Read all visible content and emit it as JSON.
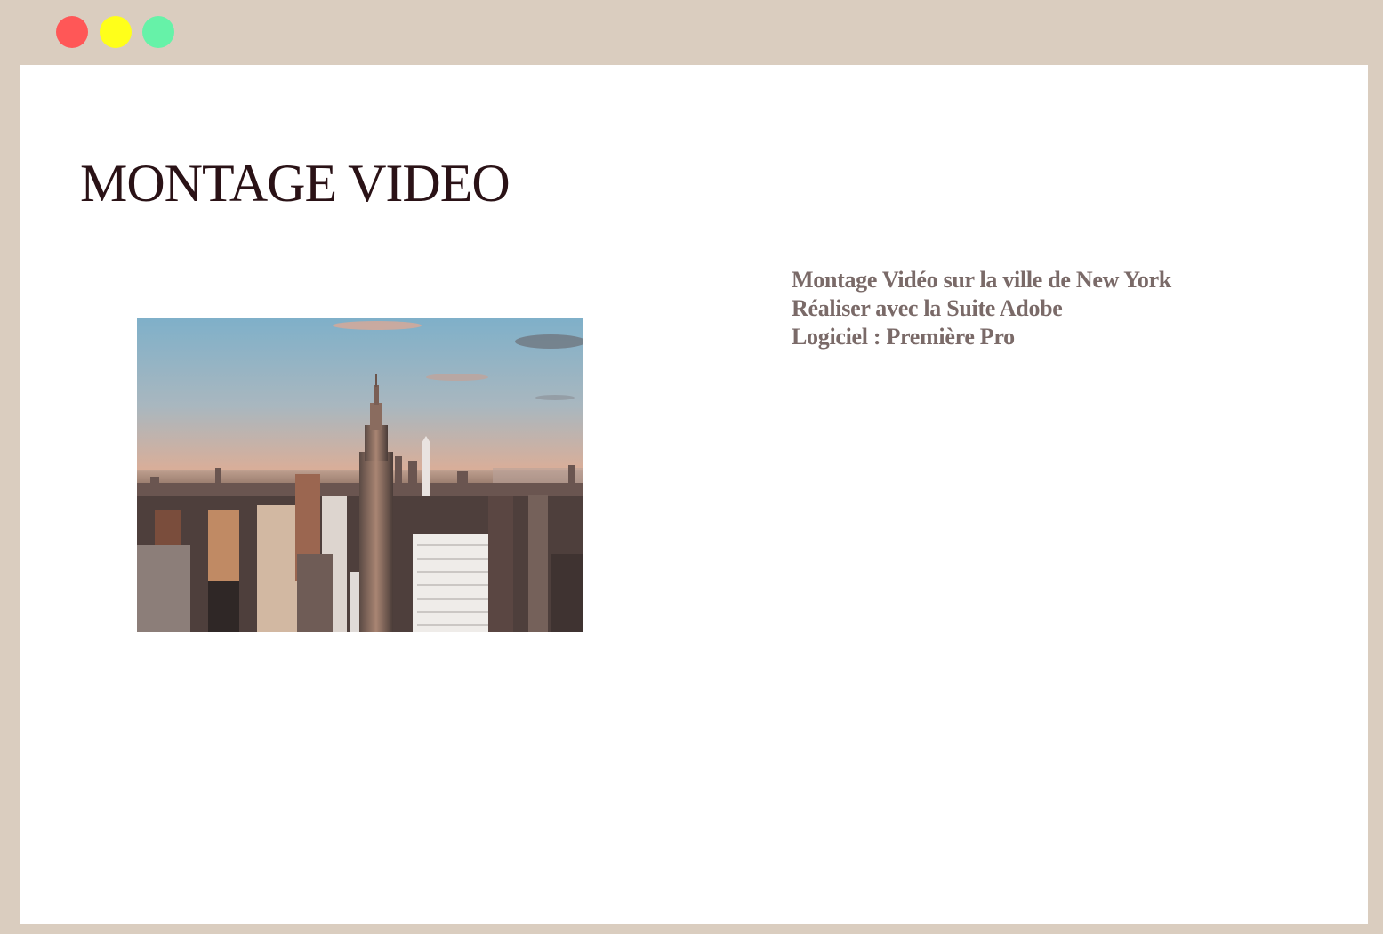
{
  "window": {
    "controls": {
      "close_color": "#ff5757",
      "minimize_color": "#ffff1a",
      "maximize_color": "#66f2a8"
    },
    "frame_color": "#dacdbf"
  },
  "page": {
    "title": "MONTAGE VIDEO",
    "description": [
      "Montage Vidéo sur la ville de New York",
      "Réaliser avec la Suite Adobe",
      "Logiciel : Première Pro"
    ]
  },
  "hero_image": {
    "subject": "new-york-skyline-photo"
  }
}
